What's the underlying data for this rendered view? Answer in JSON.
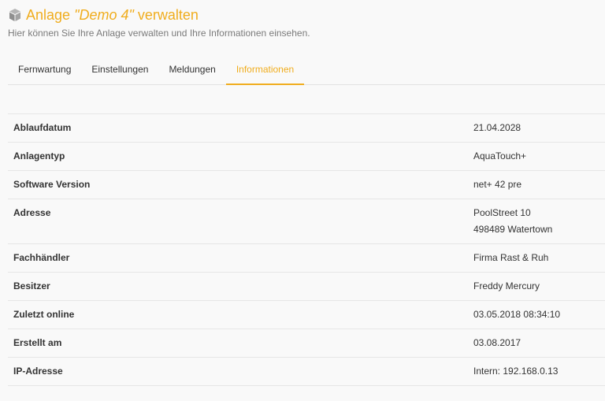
{
  "header": {
    "title_prefix": "Anlage ",
    "title_name": "\"Demo 4\"",
    "title_suffix": " verwalten",
    "subtitle": "Hier können Sie Ihre Anlage verwalten und Ihre Informationen einsehen.",
    "icon": "cube-icon",
    "accent_color": "#f0ad1e"
  },
  "tabs": [
    {
      "label": "Fernwartung",
      "active": false
    },
    {
      "label": "Einstellungen",
      "active": false
    },
    {
      "label": "Meldungen",
      "active": false
    },
    {
      "label": "Informationen",
      "active": true
    }
  ],
  "info": [
    {
      "label": "Ablaufdatum",
      "value": [
        "21.04.2028"
      ]
    },
    {
      "label": "Anlagentyp",
      "value": [
        "AquaTouch+"
      ]
    },
    {
      "label": "Software Version",
      "value": [
        "net+ 42 pre"
      ]
    },
    {
      "label": "Adresse",
      "value": [
        "PoolStreet 10",
        "498489 Watertown"
      ]
    },
    {
      "label": "Fachhändler",
      "value": [
        "Firma Rast & Ruh"
      ]
    },
    {
      "label": "Besitzer",
      "value": [
        "Freddy Mercury"
      ]
    },
    {
      "label": "Zuletzt online",
      "value": [
        "03.05.2018 08:34:10"
      ]
    },
    {
      "label": "Erstellt am",
      "value": [
        "03.08.2017"
      ]
    },
    {
      "label": "IP-Adresse",
      "value": [
        "Intern: 192.168.0.13"
      ]
    }
  ]
}
